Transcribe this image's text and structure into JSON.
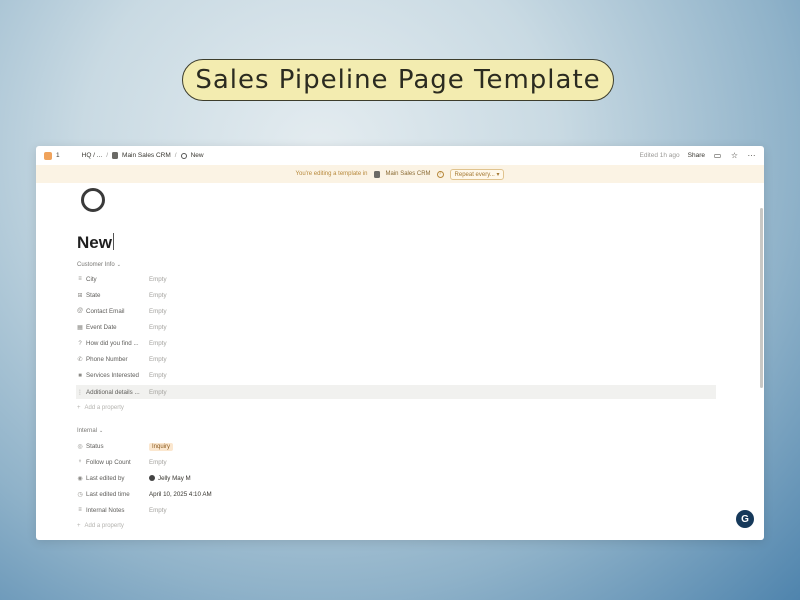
{
  "promo_title": "Sales Pipeline Page Template",
  "topbar": {
    "workspace_count": "1",
    "crumb_hq": "HQ / ...",
    "crumb_db": "Main Sales CRM",
    "crumb_page": "New",
    "edited": "Edited 1h ago",
    "share": "Share"
  },
  "banner": {
    "prefix": "You're editing a template in",
    "db_name": "Main Sales CRM",
    "repeat_label": "Repeat every..."
  },
  "page": {
    "title": "New"
  },
  "sections": {
    "customer_info": "Customer Info",
    "internal": "Internal"
  },
  "customer_props": [
    {
      "icon": "list-icon",
      "glyph": "≡",
      "name": "City",
      "value": "Empty"
    },
    {
      "icon": "table-icon",
      "glyph": "⊞",
      "name": "State",
      "value": "Empty"
    },
    {
      "icon": "at-icon",
      "glyph": "@",
      "name": "Contact Email",
      "value": "Empty"
    },
    {
      "icon": "calendar-icon",
      "glyph": "▦",
      "name": "Event Date",
      "value": "Empty"
    },
    {
      "icon": "question-icon",
      "glyph": "?",
      "name": "How did you find ...",
      "value": "Empty"
    },
    {
      "icon": "phone-icon",
      "glyph": "✆",
      "name": "Phone Number",
      "value": "Empty"
    },
    {
      "icon": "video-icon",
      "glyph": "■",
      "name": "Services Interested",
      "value": "Empty"
    },
    {
      "icon": "list-icon",
      "glyph": "⋮",
      "name": "Additional details ...",
      "value": "Empty"
    }
  ],
  "add_property": "Add a property",
  "internal_props": {
    "status": {
      "name": "Status",
      "value": "Inquiry"
    },
    "follow_up": {
      "name": "Follow up Count",
      "value": "Empty"
    },
    "last_edited_by": {
      "name": "Last edited by",
      "value": "Jelly May M"
    },
    "last_edited_time": {
      "name": "Last edited time",
      "value": "April 10, 2025 4:10 AM"
    },
    "internal_notes": {
      "name": "Internal Notes",
      "value": "Empty"
    }
  },
  "grammarly": "G"
}
